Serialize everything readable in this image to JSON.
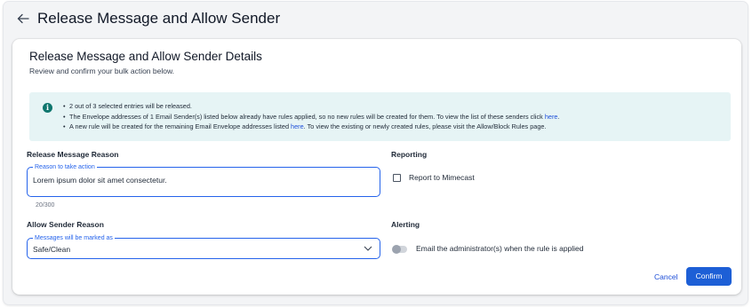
{
  "header": {
    "title": "Release Message and Allow Sender",
    "back_icon": "arrow-left-icon"
  },
  "card": {
    "title": "Release Message and Allow Sender Details",
    "subtitle": "Review and confirm your bulk action below."
  },
  "info": {
    "icon": "info-icon",
    "line1": "2 out of 3 selected entries will be released.",
    "line2_pre": "The Envelope addresses of 1 Email Sender(s) listed below already have rules applied, so no new rules will be created for them. To view the list of these senders click ",
    "line2_link": "here",
    "line2_post": ".",
    "line3_pre": "A new rule will be created for the remaining Email Envelope addresses listed ",
    "line3_link": "here",
    "line3_post": ". To view the existing or newly created rules, please visit the Allow/Block Rules page."
  },
  "release_reason": {
    "label": "Release Message Reason",
    "legend": "Reason to take action",
    "value": "Lorem ipsum dolor sit amet consectetur.",
    "counter": "20/300"
  },
  "allow_reason": {
    "label": "Allow Sender Reason",
    "legend": "Messages will be marked as",
    "selected": "Safe/Clean"
  },
  "reporting": {
    "label": "Reporting",
    "checkbox_label": "Report to Mimecast",
    "checked": false
  },
  "alerting": {
    "label": "Alerting",
    "toggle_label": "Email the administrator(s) when the rule is applied",
    "enabled": false
  },
  "actions": {
    "cancel_label": "Cancel",
    "confirm_label": "Confirm"
  },
  "colors": {
    "accent": "#1d5fd6",
    "info_bg": "#e6f4f5",
    "info_icon": "#0f766e"
  }
}
